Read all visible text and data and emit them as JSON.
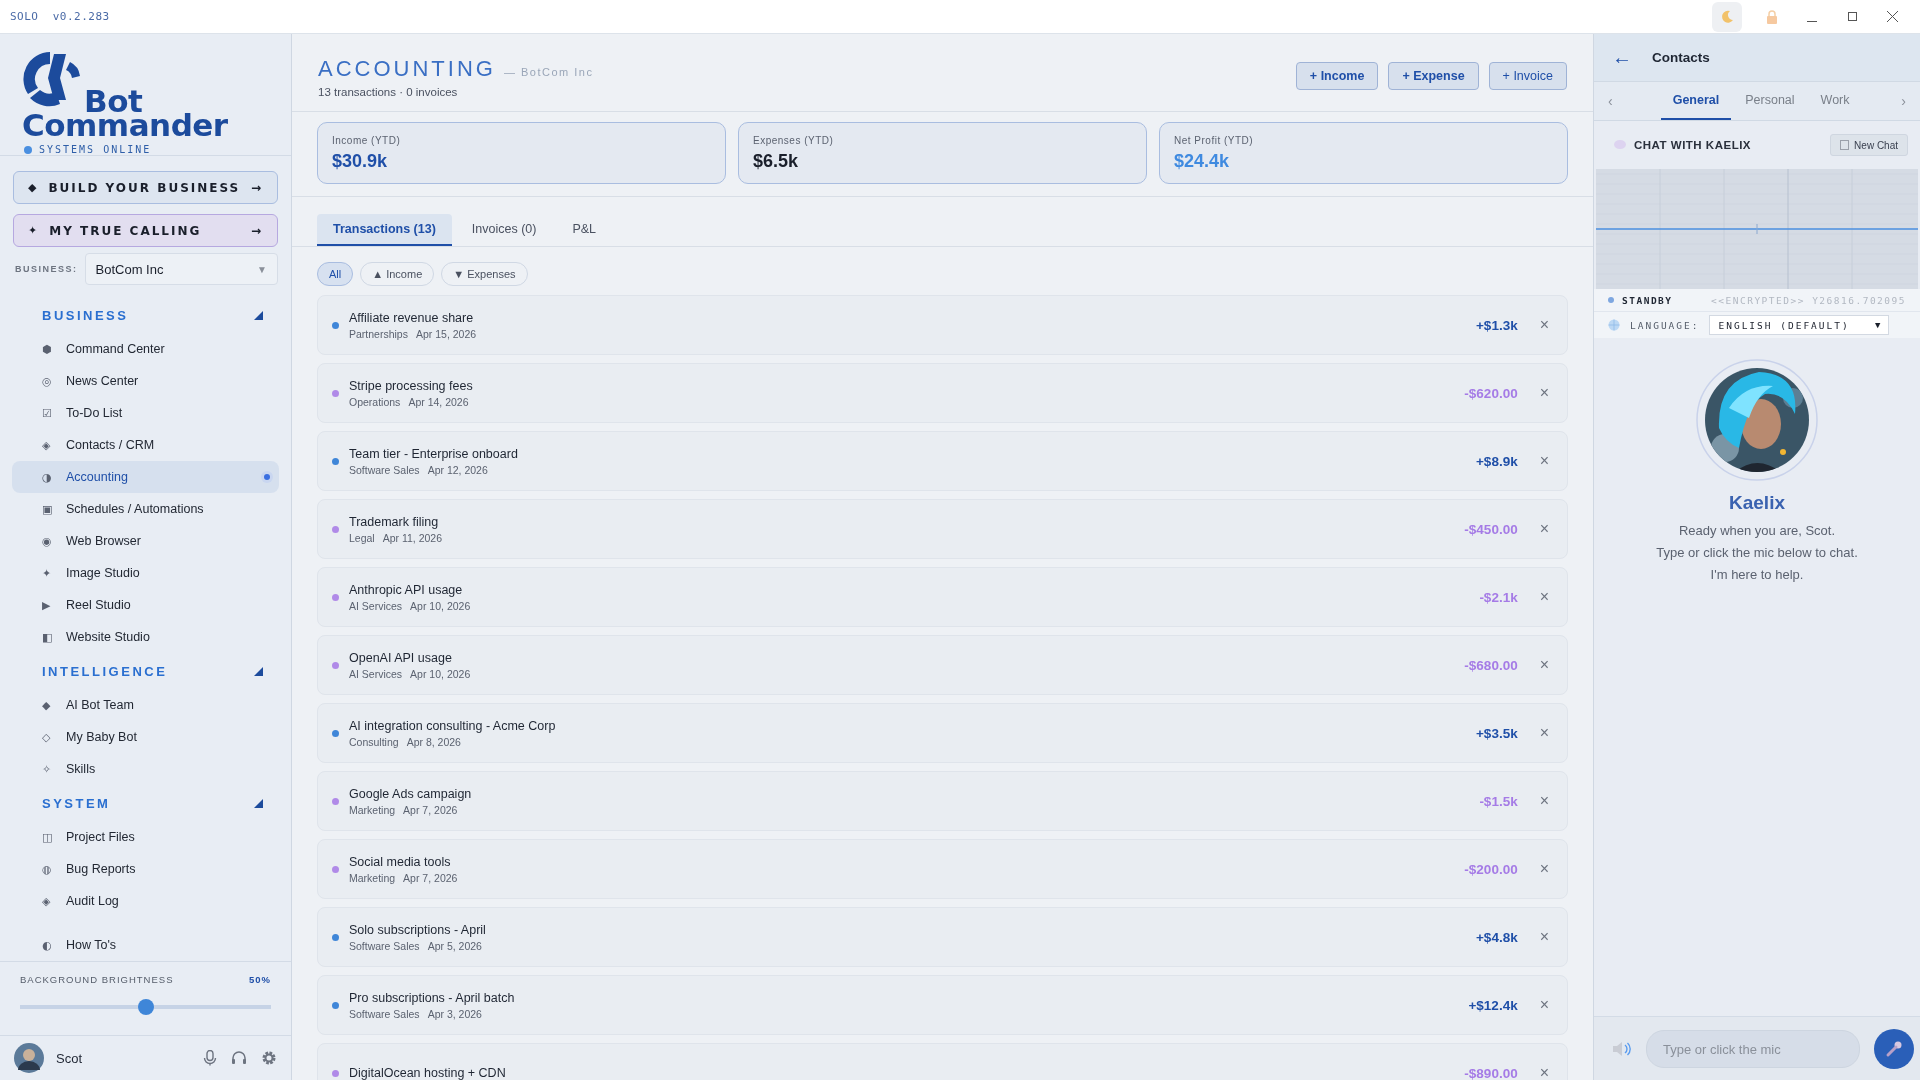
{
  "titlebar": {
    "app": "SOLO",
    "version": "v0.2.283"
  },
  "sidebar": {
    "logo": {
      "line1": "Bot",
      "line2": "Commander",
      "status": "SYSTEMS ONLINE"
    },
    "actions": [
      {
        "kind": "build",
        "icon": "◆",
        "label": "BUILD YOUR BUSINESS",
        "arrow": "→"
      },
      {
        "kind": "calling",
        "icon": "✦",
        "label": "MY TRUE CALLING",
        "arrow": "→"
      }
    ],
    "business": {
      "label": "BUSINESS:",
      "value": "BotCom Inc",
      "caret": "▼"
    },
    "sections": [
      {
        "title": "BUSINESS",
        "expanded": true,
        "items": [
          {
            "icon": "⬢",
            "label": "Command Center",
            "selected": false
          },
          {
            "icon": "◎",
            "label": "News Center",
            "selected": false
          },
          {
            "icon": "☑",
            "label": "To-Do List",
            "selected": false
          },
          {
            "icon": "◈",
            "label": "Contacts / CRM",
            "selected": false
          },
          {
            "icon": "◑",
            "label": "Accounting",
            "selected": true
          },
          {
            "icon": "▣",
            "label": "Schedules / Automations",
            "selected": false
          },
          {
            "icon": "◉",
            "label": "Web Browser",
            "selected": false
          },
          {
            "icon": "✦",
            "label": "Image Studio",
            "selected": false
          },
          {
            "icon": "▶",
            "label": "Reel Studio",
            "selected": false
          },
          {
            "icon": "◧",
            "label": "Website Studio",
            "selected": false
          }
        ]
      },
      {
        "title": "INTELLIGENCE",
        "expanded": true,
        "items": [
          {
            "icon": "◆",
            "label": "AI Bot Team",
            "selected": false
          },
          {
            "icon": "◇",
            "label": "My Baby Bot",
            "selected": false
          },
          {
            "icon": "✧",
            "label": "Skills",
            "selected": false
          }
        ]
      },
      {
        "title": "SYSTEM",
        "expanded": true,
        "items": [
          {
            "icon": "◫",
            "label": "Project Files",
            "selected": false
          },
          {
            "icon": "◍",
            "label": "Bug Reports",
            "selected": false
          },
          {
            "icon": "◈",
            "label": "Audit Log",
            "selected": false
          }
        ]
      }
    ],
    "footer_item": {
      "icon": "◐",
      "label": "How To's",
      "selected": false
    },
    "brightness": {
      "label": "BACKGROUND BRIGHTNESS",
      "reading": "50%",
      "level": 0.5
    },
    "user": {
      "name": "Scot"
    }
  },
  "main": {
    "title": "ACCOUNTING",
    "subtitle": "— BotCom Inc",
    "summary": "13 transactions · 0 invoices",
    "buttons": [
      "+ Income",
      "+ Expense",
      "+ Invoice"
    ],
    "stats": [
      {
        "kind": "income",
        "label": "Income (YTD)",
        "value": "$30.9k"
      },
      {
        "kind": "expense",
        "label": "Expenses (YTD)",
        "value": "$6.5k"
      },
      {
        "kind": "net",
        "label": "Net Profit (YTD)",
        "value": "$24.4k"
      }
    ],
    "tabs": [
      {
        "label": "Transactions (13)",
        "selected": true
      },
      {
        "label": "Invoices (0)",
        "selected": false
      },
      {
        "label": "P&L",
        "selected": false
      }
    ],
    "filters": [
      {
        "label": "All",
        "selected": true
      },
      {
        "label": "▲ Income",
        "selected": false
      },
      {
        "label": "▼ Expenses",
        "selected": false
      }
    ],
    "transactions": [
      {
        "kind": "income",
        "title": "Affiliate revenue share",
        "category": "Partnerships",
        "date": "Apr 15, 2026",
        "amount": "+$1.3k",
        "remove": "×"
      },
      {
        "kind": "expense",
        "title": "Stripe processing fees",
        "category": "Operations",
        "date": "Apr 14, 2026",
        "amount": "-$620.00",
        "remove": "×"
      },
      {
        "kind": "income",
        "title": "Team tier - Enterprise onboard",
        "category": "Software Sales",
        "date": "Apr 12, 2026",
        "amount": "+$8.9k",
        "remove": "×"
      },
      {
        "kind": "expense",
        "title": "Trademark filing",
        "category": "Legal",
        "date": "Apr 11, 2026",
        "amount": "-$450.00",
        "remove": "×"
      },
      {
        "kind": "expense",
        "title": "Anthropic API usage",
        "category": "AI Services",
        "date": "Apr 10, 2026",
        "amount": "-$2.1k",
        "remove": "×"
      },
      {
        "kind": "expense",
        "title": "OpenAI API usage",
        "category": "AI Services",
        "date": "Apr 10, 2026",
        "amount": "-$680.00",
        "remove": "×"
      },
      {
        "kind": "income",
        "title": "AI integration consulting - Acme Corp",
        "category": "Consulting",
        "date": "Apr 8, 2026",
        "amount": "+$3.5k",
        "remove": "×"
      },
      {
        "kind": "expense",
        "title": "Google Ads campaign",
        "category": "Marketing",
        "date": "Apr 7, 2026",
        "amount": "-$1.5k",
        "remove": "×"
      },
      {
        "kind": "expense",
        "title": "Social media tools",
        "category": "Marketing",
        "date": "Apr 7, 2026",
        "amount": "-$200.00",
        "remove": "×"
      },
      {
        "kind": "income",
        "title": "Solo subscriptions - April",
        "category": "Software Sales",
        "date": "Apr 5, 2026",
        "amount": "+$4.8k",
        "remove": "×"
      },
      {
        "kind": "income",
        "title": "Pro subscriptions - April batch",
        "category": "Software Sales",
        "date": "Apr 3, 2026",
        "amount": "+$12.4k",
        "remove": "×"
      },
      {
        "kind": "expense",
        "title": "DigitalOcean hosting + CDN",
        "amount": "-$890.00",
        "remove": "×"
      }
    ]
  },
  "chat_panel": {
    "back": "←",
    "title": "Contacts",
    "prev": "‹",
    "next": "›",
    "tabs": [
      {
        "label": "General",
        "selected": true
      },
      {
        "label": "Personal",
        "selected": false
      },
      {
        "label": "Work",
        "selected": false
      }
    ],
    "chat_title": "CHAT WITH KAELIX",
    "new_chat": "New Chat",
    "status": {
      "label": "STANDBY",
      "code": "<<ENCRYPTED>> Y26816.702095"
    },
    "language": {
      "label": "LANGUAGE:",
      "value": "ENGLISH (DEFAULT)",
      "caret": "▼"
    },
    "assistant": {
      "name": "Kaelix",
      "lines": [
        "Ready when you are, Scot.",
        "Type or click the mic below to chat.",
        "I'm here to help."
      ]
    },
    "input": {
      "placeholder": "Type or click the mic"
    }
  }
}
